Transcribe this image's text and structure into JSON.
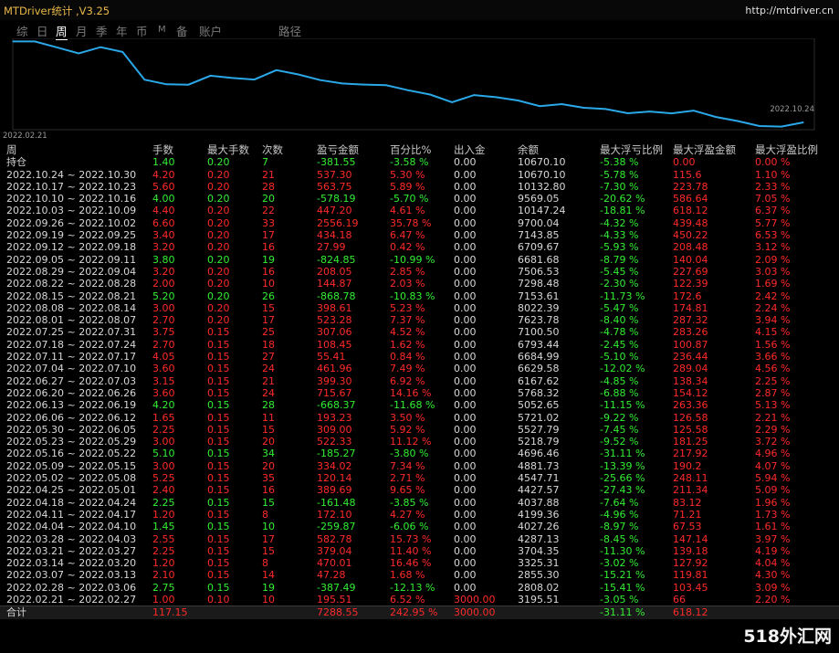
{
  "window": {
    "title": "MTDriver统计 ,V3.25",
    "url": "http://mtdriver.cn"
  },
  "tabs": [
    {
      "label": "综",
      "active": false
    },
    {
      "label": "日",
      "active": false
    },
    {
      "label": "周",
      "active": true
    },
    {
      "label": "月",
      "active": false
    },
    {
      "label": "季",
      "active": false
    },
    {
      "label": "年",
      "active": false
    },
    {
      "label": "币",
      "active": false
    },
    {
      "label": "M",
      "active": false
    },
    {
      "label": "备",
      "active": false
    },
    {
      "label": "账户",
      "active": false
    },
    {
      "label": "路径",
      "active": false
    }
  ],
  "chart_data": {
    "type": "line",
    "x_start_label": "2022.02.21",
    "x_end_label": "2022.10.24",
    "line_color": "#2aa8e8",
    "values": [
      3195.51,
      2808.02,
      2855.3,
      3325.31,
      3704.35,
      4287.13,
      4027.26,
      4199.36,
      4037.88,
      4427.57,
      4547.71,
      4881.73,
      4696.46,
      5218.79,
      5527.79,
      5721.02,
      5052.65,
      5768.32,
      6167.62,
      6629.58,
      6684.99,
      6793.44,
      7100.5,
      7623.78,
      8022.39,
      7153.61,
      7298.48,
      7506.53,
      6681.68,
      6709.67,
      7143.85,
      9700.04,
      10147.24,
      9569.05,
      10132.8,
      10670.1,
      10670.1
    ]
  },
  "table": {
    "columns": [
      "周",
      "手数",
      "最大手数",
      "次数",
      "盈亏金额",
      "百分比%",
      "出入金",
      "余额",
      "最大浮亏比例",
      "最大浮盈金额",
      "最大浮盈比例"
    ],
    "rows": [
      [
        "持仓",
        "1.40",
        "0.20",
        "7",
        "-381.55",
        "-3.58 %",
        "0.00",
        "10670.10",
        "-5.38 %",
        "0.00",
        "0.00 %"
      ],
      [
        "2022.10.24 ~ 2022.10.30",
        "4.20",
        "0.20",
        "21",
        "537.30",
        "5.30 %",
        "0.00",
        "10670.10",
        "-5.78 %",
        "115.6",
        "1.10 %"
      ],
      [
        "2022.10.17 ~ 2022.10.23",
        "5.60",
        "0.20",
        "28",
        "563.75",
        "5.89 %",
        "0.00",
        "10132.80",
        "-7.30 %",
        "223.78",
        "2.33 %"
      ],
      [
        "2022.10.10 ~ 2022.10.16",
        "4.00",
        "0.20",
        "20",
        "-578.19",
        "-5.70 %",
        "0.00",
        "9569.05",
        "-20.62 %",
        "586.64",
        "7.05 %"
      ],
      [
        "2022.10.03 ~ 2022.10.09",
        "4.40",
        "0.20",
        "22",
        "447.20",
        "4.61 %",
        "0.00",
        "10147.24",
        "-18.81 %",
        "618.12",
        "6.37 %"
      ],
      [
        "2022.09.26 ~ 2022.10.02",
        "6.60",
        "0.20",
        "33",
        "2556.19",
        "35.78 %",
        "0.00",
        "9700.04",
        "-4.32 %",
        "439.48",
        "5.77 %"
      ],
      [
        "2022.09.19 ~ 2022.09.25",
        "3.40",
        "0.20",
        "17",
        "434.18",
        "6.47 %",
        "0.00",
        "7143.85",
        "-4.33 %",
        "450.22",
        "6.53 %"
      ],
      [
        "2022.09.12 ~ 2022.09.18",
        "3.20",
        "0.20",
        "16",
        "27.99",
        "0.42 %",
        "0.00",
        "6709.67",
        "-5.93 %",
        "208.48",
        "3.12 %"
      ],
      [
        "2022.09.05 ~ 2022.09.11",
        "3.80",
        "0.20",
        "19",
        "-824.85",
        "-10.99 %",
        "0.00",
        "6681.68",
        "-8.79 %",
        "140.04",
        "2.09 %"
      ],
      [
        "2022.08.29 ~ 2022.09.04",
        "3.20",
        "0.20",
        "16",
        "208.05",
        "2.85 %",
        "0.00",
        "7506.53",
        "-5.45 %",
        "227.69",
        "3.03 %"
      ],
      [
        "2022.08.22 ~ 2022.08.28",
        "2.00",
        "0.20",
        "10",
        "144.87",
        "2.03 %",
        "0.00",
        "7298.48",
        "-2.30 %",
        "122.39",
        "1.69 %"
      ],
      [
        "2022.08.15 ~ 2022.08.21",
        "5.20",
        "0.20",
        "26",
        "-868.78",
        "-10.83 %",
        "0.00",
        "7153.61",
        "-11.73 %",
        "172.6",
        "2.42 %"
      ],
      [
        "2022.08.08 ~ 2022.08.14",
        "3.00",
        "0.20",
        "15",
        "398.61",
        "5.23 %",
        "0.00",
        "8022.39",
        "-5.47 %",
        "174.81",
        "2.24 %"
      ],
      [
        "2022.08.01 ~ 2022.08.07",
        "2.70",
        "0.20",
        "17",
        "523.28",
        "7.37 %",
        "0.00",
        "7623.78",
        "-8.40 %",
        "287.32",
        "3.94 %"
      ],
      [
        "2022.07.25 ~ 2022.07.31",
        "3.75",
        "0.15",
        "25",
        "307.06",
        "4.52 %",
        "0.00",
        "7100.50",
        "-4.78 %",
        "283.26",
        "4.15 %"
      ],
      [
        "2022.07.18 ~ 2022.07.24",
        "2.70",
        "0.15",
        "18",
        "108.45",
        "1.62 %",
        "0.00",
        "6793.44",
        "-2.45 %",
        "100.87",
        "1.56 %"
      ],
      [
        "2022.07.11 ~ 2022.07.17",
        "4.05",
        "0.15",
        "27",
        "55.41",
        "0.84 %",
        "0.00",
        "6684.99",
        "-5.10 %",
        "236.44",
        "3.66 %"
      ],
      [
        "2022.07.04 ~ 2022.07.10",
        "3.60",
        "0.15",
        "24",
        "461.96",
        "7.49 %",
        "0.00",
        "6629.58",
        "-12.02 %",
        "289.04",
        "4.56 %"
      ],
      [
        "2022.06.27 ~ 2022.07.03",
        "3.15",
        "0.15",
        "21",
        "399.30",
        "6.92 %",
        "0.00",
        "6167.62",
        "-4.85 %",
        "138.34",
        "2.25 %"
      ],
      [
        "2022.06.20 ~ 2022.06.26",
        "3.60",
        "0.15",
        "24",
        "715.67",
        "14.16 %",
        "0.00",
        "5768.32",
        "-6.88 %",
        "154.12",
        "2.87 %"
      ],
      [
        "2022.06.13 ~ 2022.06.19",
        "4.20",
        "0.15",
        "28",
        "-668.37",
        "-11.68 %",
        "0.00",
        "5052.65",
        "-11.15 %",
        "263.36",
        "5.13 %"
      ],
      [
        "2022.06.06 ~ 2022.06.12",
        "1.65",
        "0.15",
        "11",
        "193.23",
        "3.50 %",
        "0.00",
        "5721.02",
        "-9.22 %",
        "126.58",
        "2.21 %"
      ],
      [
        "2022.05.30 ~ 2022.06.05",
        "2.25",
        "0.15",
        "15",
        "309.00",
        "5.92 %",
        "0.00",
        "5527.79",
        "-7.45 %",
        "125.58",
        "2.29 %"
      ],
      [
        "2022.05.23 ~ 2022.05.29",
        "3.00",
        "0.15",
        "20",
        "522.33",
        "11.12 %",
        "0.00",
        "5218.79",
        "-9.52 %",
        "181.25",
        "3.72 %"
      ],
      [
        "2022.05.16 ~ 2022.05.22",
        "5.10",
        "0.15",
        "34",
        "-185.27",
        "-3.80 %",
        "0.00",
        "4696.46",
        "-31.11 %",
        "217.92",
        "4.96 %"
      ],
      [
        "2022.05.09 ~ 2022.05.15",
        "3.00",
        "0.15",
        "20",
        "334.02",
        "7.34 %",
        "0.00",
        "4881.73",
        "-13.39 %",
        "190.2",
        "4.07 %"
      ],
      [
        "2022.05.02 ~ 2022.05.08",
        "5.25",
        "0.15",
        "35",
        "120.14",
        "2.71 %",
        "0.00",
        "4547.71",
        "-25.66 %",
        "248.11",
        "5.94 %"
      ],
      [
        "2022.04.25 ~ 2022.05.01",
        "2.40",
        "0.15",
        "16",
        "389.69",
        "9.65 %",
        "0.00",
        "4427.57",
        "-27.43 %",
        "211.34",
        "5.09 %"
      ],
      [
        "2022.04.18 ~ 2022.04.24",
        "2.25",
        "0.15",
        "15",
        "-161.48",
        "-3.85 %",
        "0.00",
        "4037.88",
        "-7.64 %",
        "83.12",
        "1.96 %"
      ],
      [
        "2022.04.11 ~ 2022.04.17",
        "1.20",
        "0.15",
        "8",
        "172.10",
        "4.27 %",
        "0.00",
        "4199.36",
        "-4.96 %",
        "71.21",
        "1.73 %"
      ],
      [
        "2022.04.04 ~ 2022.04.10",
        "1.45",
        "0.15",
        "10",
        "-259.87",
        "-6.06 %",
        "0.00",
        "4027.26",
        "-8.97 %",
        "67.53",
        "1.61 %"
      ],
      [
        "2022.03.28 ~ 2022.04.03",
        "2.55",
        "0.15",
        "17",
        "582.78",
        "15.73 %",
        "0.00",
        "4287.13",
        "-8.45 %",
        "147.14",
        "3.97 %"
      ],
      [
        "2022.03.21 ~ 2022.03.27",
        "2.25",
        "0.15",
        "15",
        "379.04",
        "11.40 %",
        "0.00",
        "3704.35",
        "-11.30 %",
        "139.18",
        "4.19 %"
      ],
      [
        "2022.03.14 ~ 2022.03.20",
        "1.20",
        "0.15",
        "8",
        "470.01",
        "16.46 %",
        "0.00",
        "3325.31",
        "-3.02 %",
        "127.92",
        "4.04 %"
      ],
      [
        "2022.03.07 ~ 2022.03.13",
        "2.10",
        "0.15",
        "14",
        "47.28",
        "1.68 %",
        "0.00",
        "2855.30",
        "-15.21 %",
        "119.81",
        "4.30 %"
      ],
      [
        "2022.02.28 ~ 2022.03.06",
        "2.75",
        "0.15",
        "19",
        "-387.49",
        "-12.13 %",
        "0.00",
        "2808.02",
        "-15.41 %",
        "103.45",
        "3.09 %"
      ],
      [
        "2022.02.21 ~ 2022.02.27",
        "1.00",
        "0.10",
        "10",
        "195.51",
        "6.52 %",
        "3000.00",
        "3195.51",
        "-3.05 %",
        "66",
        "2.20 %"
      ]
    ],
    "total": [
      "合计",
      "117.15",
      "",
      "",
      "7288.55",
      "242.95 %",
      "3000.00",
      "",
      "-31.11 %",
      "618.12",
      ""
    ]
  },
  "colors": {
    "positive": "#ff2a2a",
    "negative": "#33ee33",
    "neutral": "#d8d8d8",
    "header": "#c8c8c8"
  },
  "watermark": "518外汇网"
}
